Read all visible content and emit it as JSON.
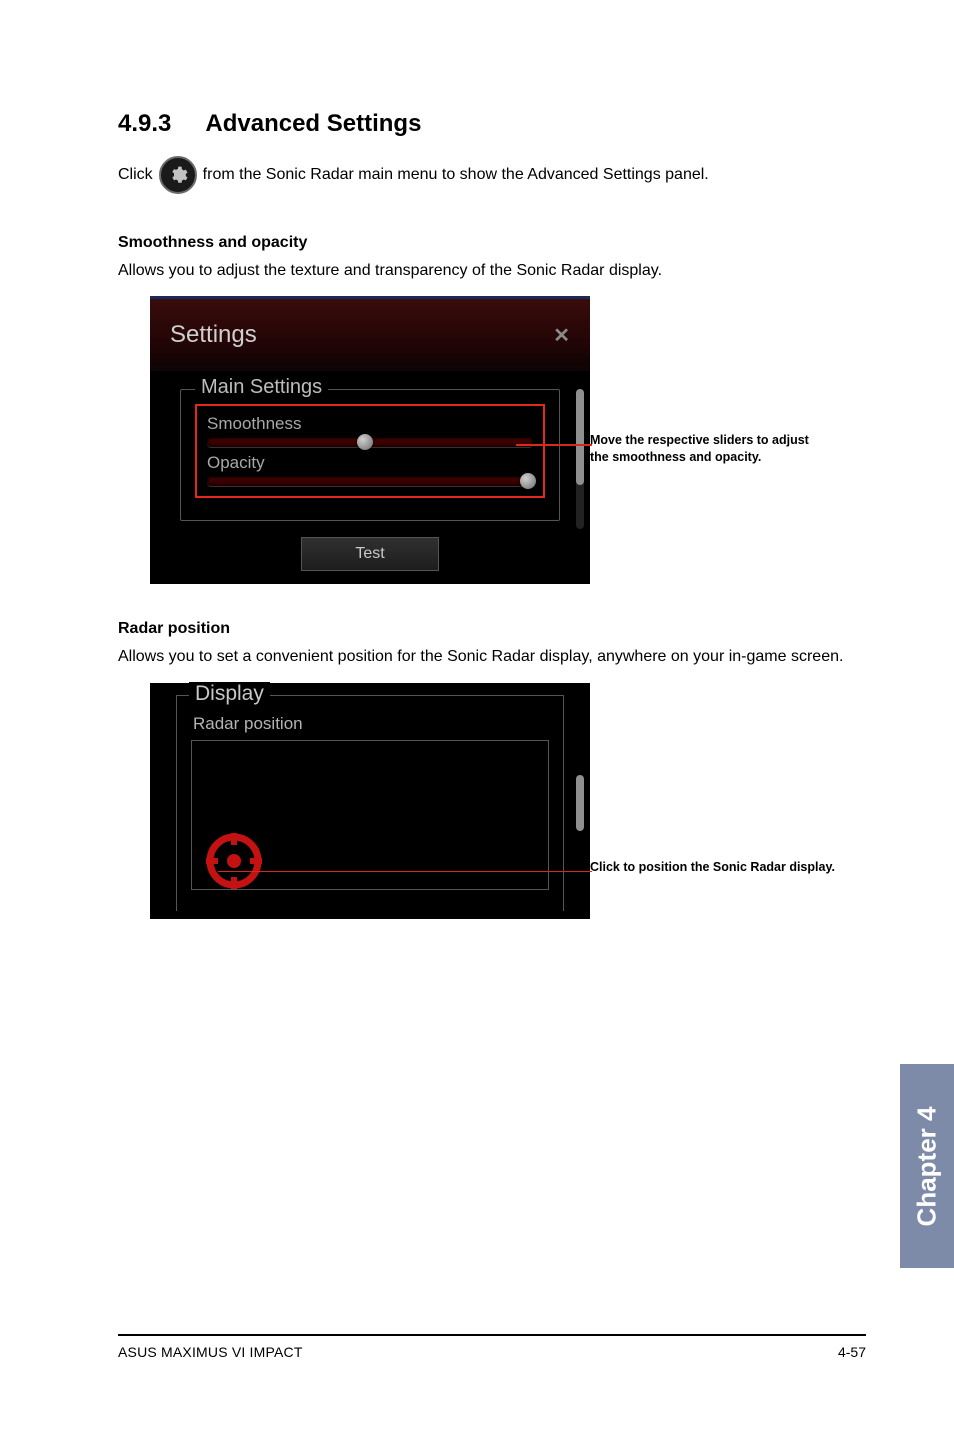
{
  "section": {
    "number": "4.9.3",
    "title": "Advanced Settings"
  },
  "intro": {
    "before": "Click",
    "after": "from the Sonic Radar main menu to show the Advanced Settings panel.",
    "icon_name": "gear-icon"
  },
  "smoothness_section": {
    "heading": "Smoothness and opacity",
    "body": "Allows you to adjust the texture and transparency of the Sonic Radar display.",
    "panel": {
      "title": "Settings",
      "close_glyph": "✕",
      "group_legend": "Main Settings",
      "sliders": {
        "smoothness": {
          "label": "Smoothness",
          "value_pct": 46
        },
        "opacity": {
          "label": "Opacity",
          "value_pct": 96
        }
      },
      "test_button": "Test"
    },
    "callout": "Move the respective sliders to adjust the smoothness and opacity."
  },
  "radar_section": {
    "heading": "Radar position",
    "body": "Allows you to set a convenient position for the Sonic Radar display, anywhere on your in-game screen.",
    "panel": {
      "group_legend": "Display",
      "radar_label": "Radar position"
    },
    "callout": "Click to position the Sonic Radar display."
  },
  "side_tab": "Chapter 4",
  "footer": {
    "left": "ASUS MAXIMUS VI IMPACT",
    "right": "4-57"
  }
}
